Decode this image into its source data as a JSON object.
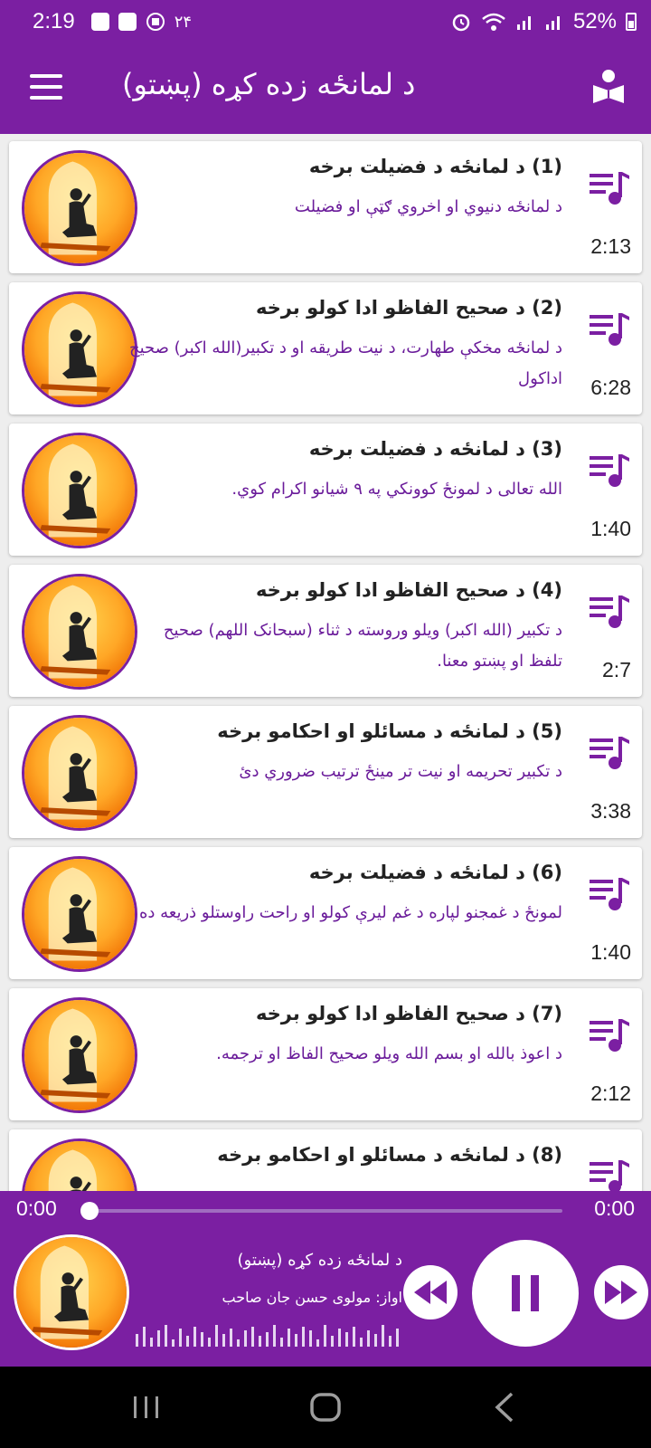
{
  "status_bar": {
    "time": "2:19",
    "notification_count": "۲۴",
    "battery_percent": "52%"
  },
  "app_bar": {
    "title": "د لمانځه زده کړه (پښتو)"
  },
  "tracks": [
    {
      "title": "(1) د لمانځه د فضیلت برخه",
      "description": "د لمانځه دنیوي او اخروي ګټې او فضیلت",
      "duration": "2:13"
    },
    {
      "title": "(2) د صحیح الفاظو ادا کولو  برخه",
      "description": "د لمانځه مخکې طهارت، د نیت طریقه او د تکبیر(الله اکبر) صحیح اداکول",
      "duration": "6:28"
    },
    {
      "title": "(3) د لمانځه د فضیلت برخه",
      "description": "الله تعالی د لمونځ کوونکي په ۹ شیانو اکرام کوي.",
      "duration": "1:40"
    },
    {
      "title": "(4) د صحیح الفاظو ادا کولو برخه",
      "description": "د تکبیر (الله اکبر) ویلو وروسته د ثناء (سبحانک اللهم) صحیح تلفظ او پښتو معنا.",
      "duration": "2:7"
    },
    {
      "title": "(5) د لمانځه د مسائلو او احکامو برخه",
      "description": "د تکبیر تحریمه او نیت تر مینځ ترتیب ضروري دئ",
      "duration": "3:38"
    },
    {
      "title": "(6) د لمانځه د فضیلت برخه",
      "description": "لمونځ د غمجنو لپاره د غم لیرې کولو او راحت راوستلو ذریعه ده",
      "duration": "1:40"
    },
    {
      "title": "(7) د صحیح الفاظو ادا کولو برخه",
      "description": "د اعوذ بالله او  بسم الله ویلو صحیح الفاظ او ترجمه.",
      "duration": "2:12"
    },
    {
      "title": "(8) د لمانځه د مسائلو او احکامو برخه",
      "description": "",
      "duration": ""
    }
  ],
  "player": {
    "current_time": "0:00",
    "total_time": "0:00",
    "progress": 0,
    "now_playing_title": "د لمانځه زده کړه (پښتو)",
    "now_playing_artist": "اواز: مولوی حسن جان صاحب",
    "state": "playing"
  },
  "colors": {
    "primary": "#7b1fa2",
    "description_text": "#6a1b9a",
    "thumb_orange": "#f7931e"
  },
  "icons": {
    "menu": "menu-icon",
    "book": "book-reader-icon",
    "queue": "queue-music-icon",
    "rewind": "rewind-icon",
    "pause": "pause-icon",
    "fast_forward": "fast-forward-icon"
  }
}
